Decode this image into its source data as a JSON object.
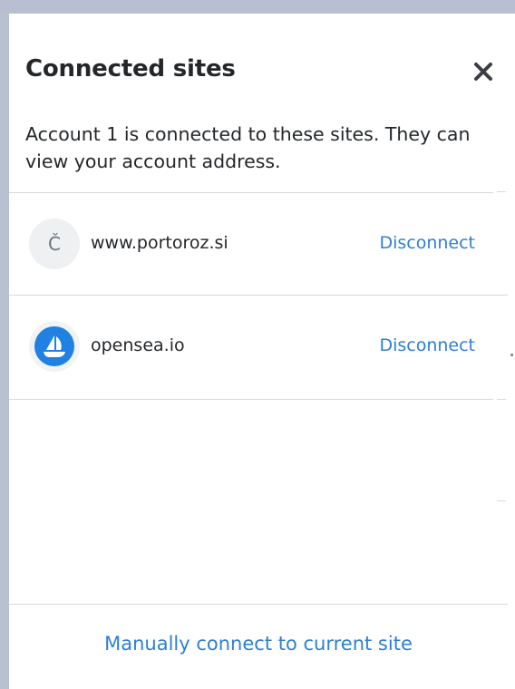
{
  "dialog": {
    "title": "Connected sites",
    "description": "Account 1 is connected to these sites. They can view your account address.",
    "close_icon": "close-icon"
  },
  "sites": [
    {
      "icon_letter": "Č",
      "name": "www.portoroz.si",
      "action_label": "Disconnect"
    },
    {
      "icon": "opensea-logo-icon",
      "name": "opensea.io",
      "action_label": "Disconnect"
    }
  ],
  "footer": {
    "link_label": "Manually connect to current site"
  },
  "colors": {
    "link": "#2f7fd3",
    "text": "#24272a",
    "divider": "#d6d9dc",
    "opensea_blue": "#2081e2"
  }
}
